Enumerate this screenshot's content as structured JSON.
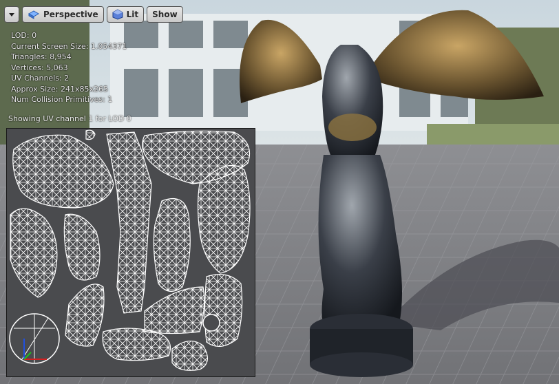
{
  "toolbar": {
    "dropdown_icon": "chevron-down-icon",
    "perspective_label": "Perspective",
    "perspective_icon": "perspective-cube-icon",
    "lit_label": "Lit",
    "lit_icon": "lit-sphere-icon",
    "show_label": "Show"
  },
  "stats": [
    {
      "label": "LOD:",
      "value": "0"
    },
    {
      "label": "Current Screen Size:",
      "value": "1.054371"
    },
    {
      "label": "Triangles:",
      "value": "8,954"
    },
    {
      "label": "Vertices:",
      "value": "5,063"
    },
    {
      "label": "UV Channels:",
      "value": "2"
    },
    {
      "label": "Approx Size:",
      "value": "241x85x265"
    },
    {
      "label": "Num Collision Primitives:",
      "value": "1"
    }
  ],
  "uv": {
    "caption": "Showing UV channel 1 for LOD 0"
  },
  "colors": {
    "toolbar_bg": "#d6d6d6",
    "overlay_text": "#e6e6e6",
    "uv_panel_bg": "#4a4b4e",
    "wireframe": "#ffffff",
    "gizmo_x": "#d12020",
    "gizmo_y": "#20c020",
    "gizmo_z": "#2050e0"
  }
}
